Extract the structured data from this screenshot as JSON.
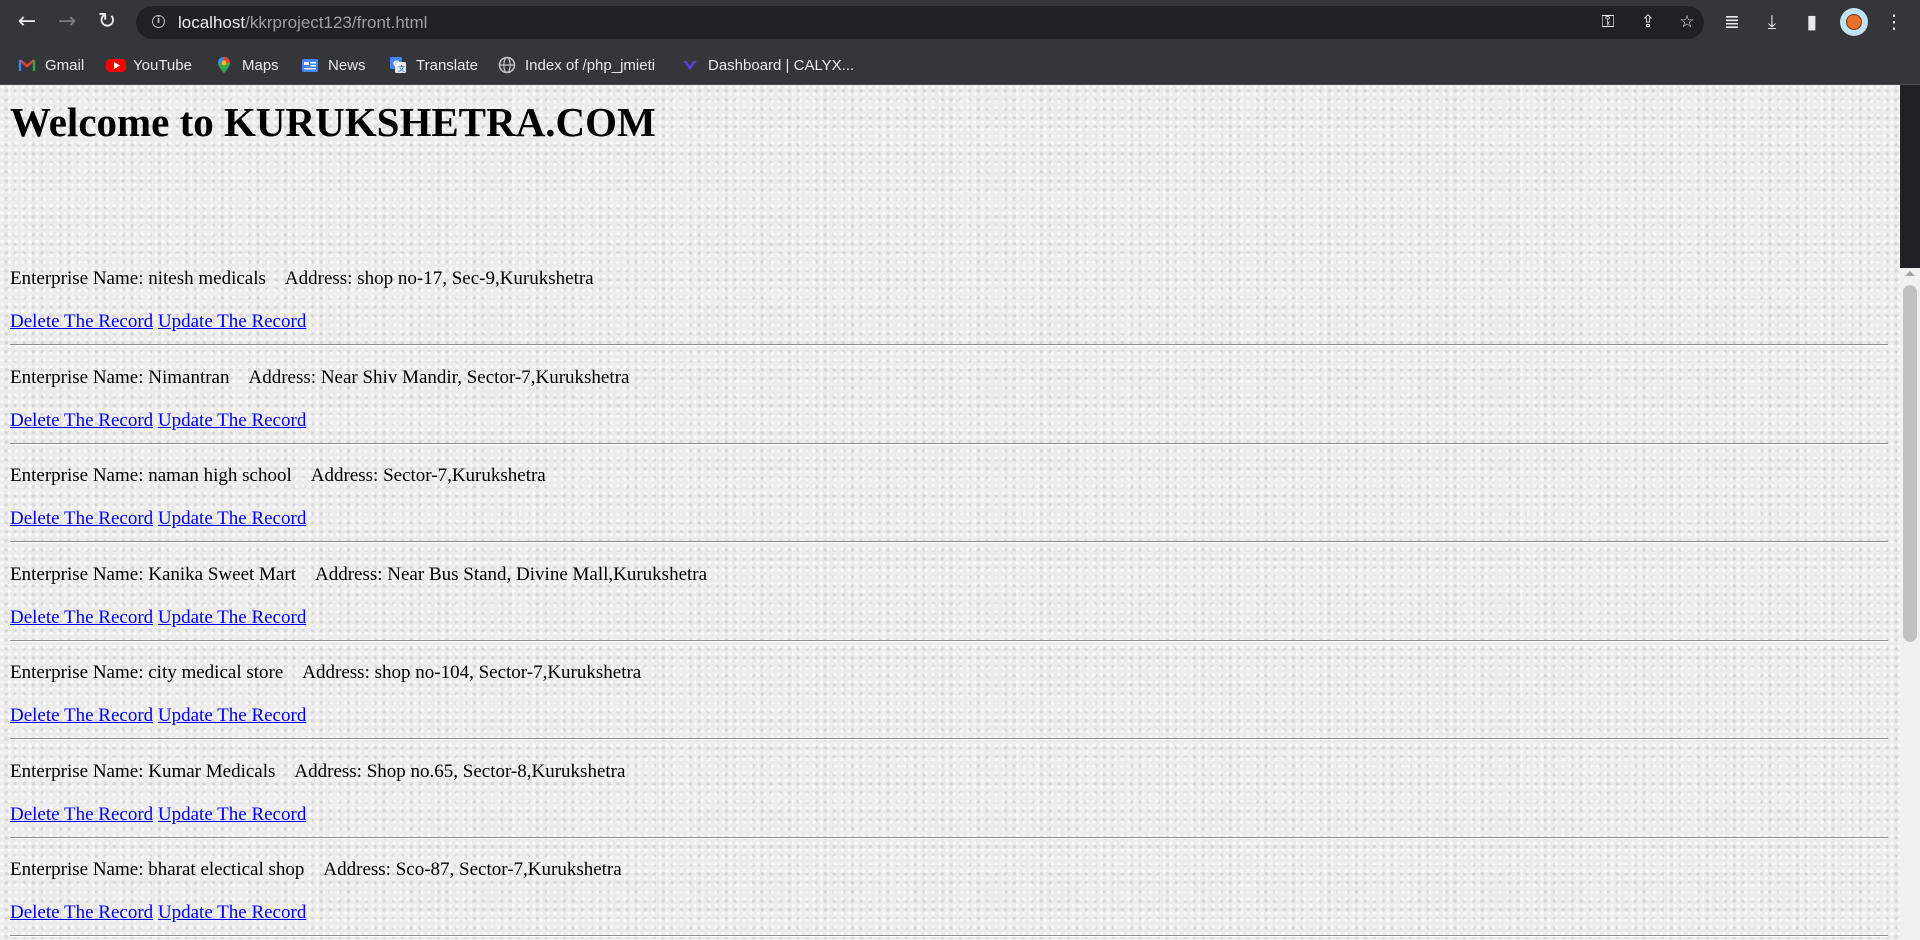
{
  "browser": {
    "url_host": "localhost",
    "url_path": "/kkrproject123/front.html",
    "bookmarks": [
      {
        "label": "Gmail",
        "icon": "gmail-icon"
      },
      {
        "label": "YouTube",
        "icon": "youtube-icon"
      },
      {
        "label": "Maps",
        "icon": "maps-icon"
      },
      {
        "label": "News",
        "icon": "news-icon"
      },
      {
        "label": "Translate",
        "icon": "translate-icon"
      },
      {
        "label": "Index of /php_jmieti",
        "icon": "globe-icon"
      },
      {
        "label": "Dashboard | CALYX...",
        "icon": "calyx-icon"
      }
    ]
  },
  "page": {
    "heading": "Welcome to KURUKSHETRA.COM",
    "delete_label": "Delete The Record",
    "update_label": "Update The Record",
    "name_prefix": "Enterprise Name: ",
    "address_prefix": "Address: ",
    "records": [
      {
        "name": "nitesh medicals",
        "address": "shop no-17, Sec-9,Kurukshetra"
      },
      {
        "name": "Nimantran",
        "address": "Near Shiv Mandir, Sector-7,Kurukshetra"
      },
      {
        "name": "naman high school",
        "address": "Sector-7,Kurukshetra"
      },
      {
        "name": "Kanika Sweet Mart",
        "address": "Near Bus Stand, Divine Mall,Kurukshetra"
      },
      {
        "name": "city medical store",
        "address": "shop no-104, Sector-7,Kurukshetra"
      },
      {
        "name": "Kumar Medicals",
        "address": "Shop no.65, Sector-8,Kurukshetra"
      },
      {
        "name": "bharat electical shop",
        "address": "Sco-87, Sector-7,Kurukshetra"
      }
    ]
  }
}
